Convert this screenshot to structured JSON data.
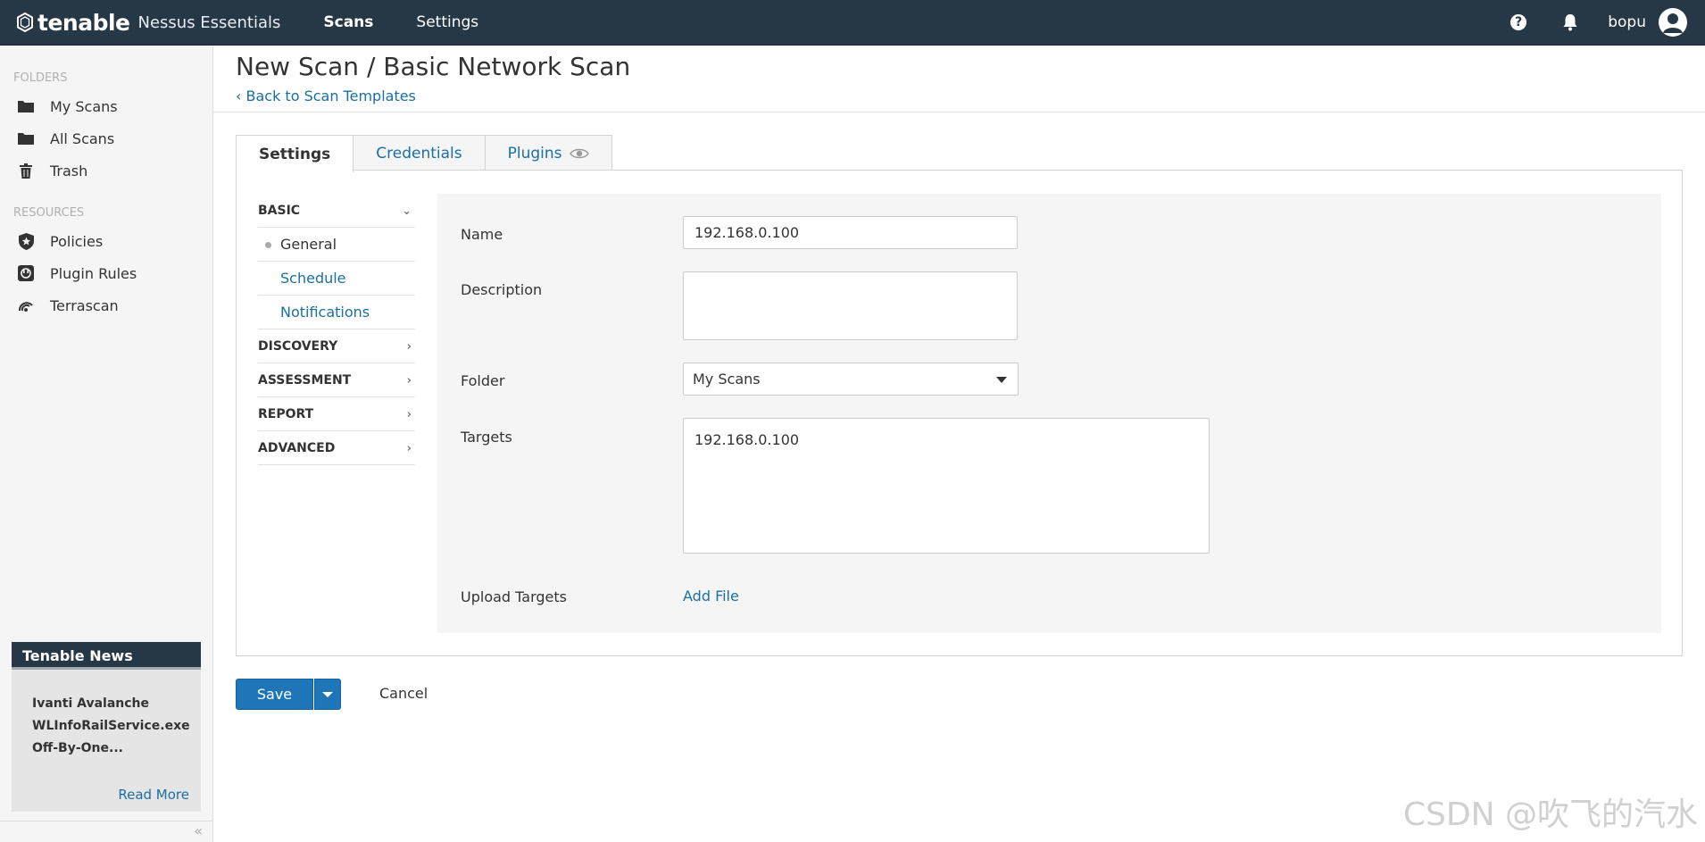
{
  "topbar": {
    "brand": "tenable",
    "product": "Nessus Essentials",
    "nav": [
      {
        "label": "Scans",
        "active": true
      },
      {
        "label": "Settings",
        "active": false
      }
    ],
    "username": "bopu"
  },
  "sidebar": {
    "folders_heading": "FOLDERS",
    "folders": [
      {
        "label": "My Scans",
        "icon": "folder-icon"
      },
      {
        "label": "All Scans",
        "icon": "folder-icon"
      },
      {
        "label": "Trash",
        "icon": "trash-icon"
      }
    ],
    "resources_heading": "RESOURCES",
    "resources": [
      {
        "label": "Policies",
        "icon": "shield-icon"
      },
      {
        "label": "Plugin Rules",
        "icon": "plugin-icon"
      },
      {
        "label": "Terrascan",
        "icon": "terrascan-icon"
      }
    ],
    "news": {
      "title": "Tenable News",
      "lines": [
        "Ivanti Avalanche",
        "WLInfoRailService.exe",
        "Off-By-One..."
      ],
      "read_more": "Read More"
    }
  },
  "page": {
    "title": "New Scan / Basic Network Scan",
    "back_link": "Back to Scan Templates"
  },
  "tabs": [
    {
      "label": "Settings",
      "active": true
    },
    {
      "label": "Credentials",
      "active": false
    },
    {
      "label": "Plugins",
      "active": false
    }
  ],
  "sections": {
    "basic": "BASIC",
    "basic_items": [
      {
        "label": "General",
        "active": true
      },
      {
        "label": "Schedule",
        "active": false
      },
      {
        "label": "Notifications",
        "active": false
      }
    ],
    "others": [
      "DISCOVERY",
      "ASSESSMENT",
      "REPORT",
      "ADVANCED"
    ]
  },
  "form": {
    "name_label": "Name",
    "name_value": "192.168.0.100",
    "description_label": "Description",
    "description_value": "",
    "folder_label": "Folder",
    "folder_value": "My Scans",
    "targets_label": "Targets",
    "targets_value": "192.168.0.100",
    "upload_label": "Upload Targets",
    "add_file": "Add File"
  },
  "actions": {
    "save": "Save",
    "cancel": "Cancel"
  },
  "watermark": "CSDN @吹飞的汽水",
  "colors": {
    "topbar": "#263746",
    "link": "#1a6fa3",
    "primary_button": "#1e75b8",
    "sidebar_bg": "#f5f5f5"
  }
}
